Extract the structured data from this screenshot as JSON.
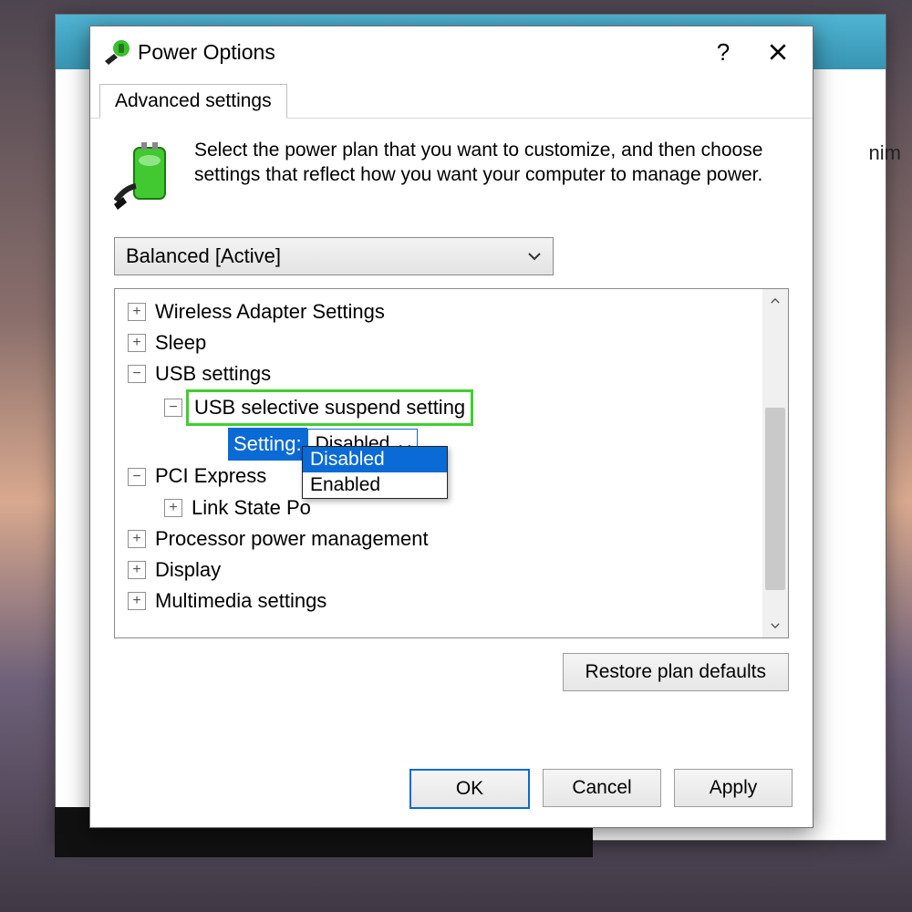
{
  "background_window": {
    "tail_text": "nim"
  },
  "dialog": {
    "title": "Power Options",
    "help_glyph": "?",
    "tab": "Advanced settings",
    "description": "Select the power plan that you want to customize, and then choose settings that reflect how you want your computer to manage power.",
    "plan_selected": "Balanced [Active]",
    "tree": {
      "wireless": "Wireless Adapter Settings",
      "sleep": "Sleep",
      "usb": "USB settings",
      "usb_suspend": "USB selective suspend setting",
      "setting_label": "Setting:",
      "setting_value": "Disabled",
      "dropdown_options": {
        "opt0": "Disabled",
        "opt1": "Enabled"
      },
      "pci": "PCI Express",
      "link_state": "Link State Po",
      "cpu": "Processor power management",
      "display": "Display",
      "multimedia": "Multimedia settings"
    },
    "restore_label": "Restore plan defaults",
    "buttons": {
      "ok": "OK",
      "cancel": "Cancel",
      "apply": "Apply"
    }
  }
}
